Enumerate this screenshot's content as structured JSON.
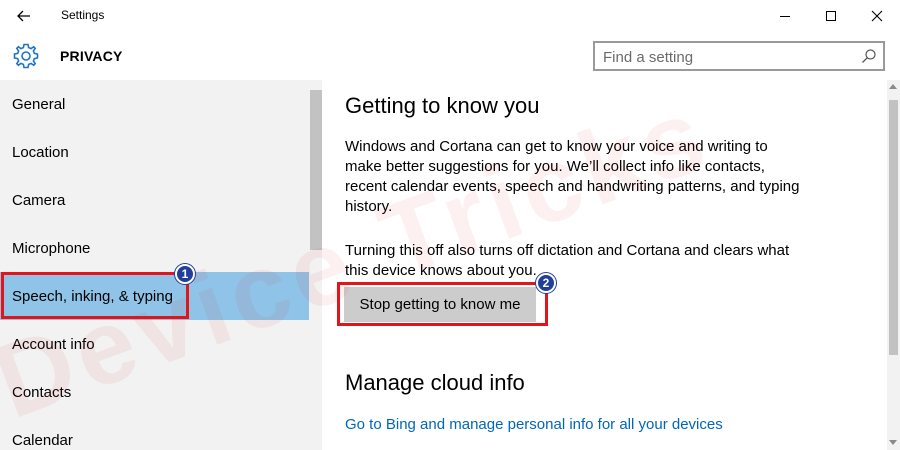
{
  "window": {
    "title": "Settings",
    "back_icon": "back-arrow-icon",
    "controls": [
      "minimize-icon",
      "maximize-icon",
      "close-icon"
    ]
  },
  "header": {
    "icon": "gear-icon",
    "section_title": "PRIVACY",
    "search_placeholder": "Find a setting",
    "search_icon": "search-icon"
  },
  "sidebar": {
    "items": [
      {
        "label": "General"
      },
      {
        "label": "Location"
      },
      {
        "label": "Camera"
      },
      {
        "label": "Microphone"
      },
      {
        "label": "Speech, inking, & typing",
        "selected": true
      },
      {
        "label": "Account info"
      },
      {
        "label": "Contacts"
      },
      {
        "label": "Calendar"
      }
    ]
  },
  "main": {
    "heading": "Getting to know you",
    "paragraph1": "Windows and Cortana can get to know your voice and writing to make better suggestions for you. We’ll collect info like contacts, recent calendar events, speech and handwriting patterns, and typing history.",
    "paragraph2": "Turning this off also turns off dictation and Cortana and clears what this device knows about you.",
    "stop_button": "Stop getting to know me",
    "heading2": "Manage cloud info",
    "bing_link": "Go to Bing and manage personal info for all your devices"
  },
  "annotations": {
    "badge1": "1",
    "badge2": "2",
    "highlight_color": "#e3141a",
    "badge_color": "#1f3f9b"
  },
  "watermark": "Device Tricks",
  "colors": {
    "selected_nav": "#8fc3e8",
    "link": "#0067b8",
    "sidebar_bg": "#f2f2f2",
    "button_bg": "#cccccc"
  }
}
